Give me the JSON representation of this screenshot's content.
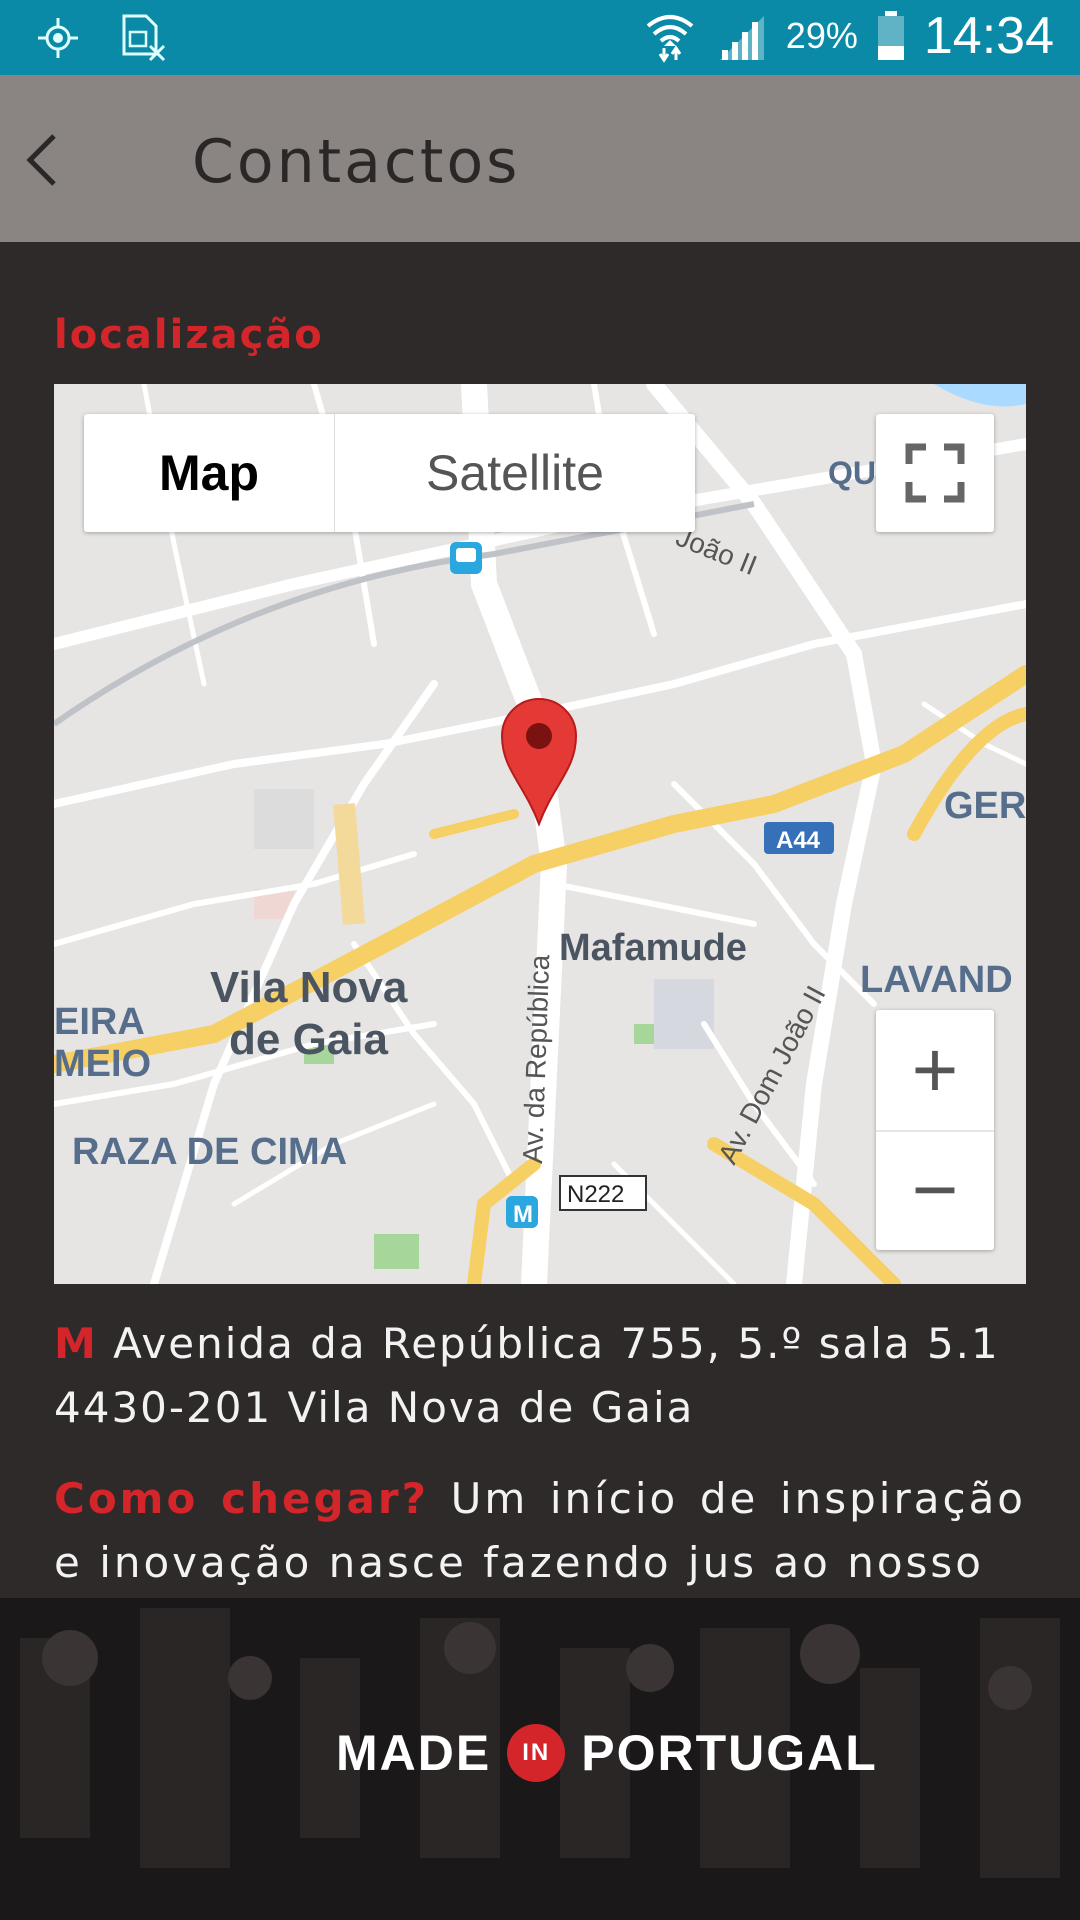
{
  "status_bar": {
    "battery_percent": "29%",
    "time": "14:34",
    "icons": [
      "location-icon",
      "sim-off-icon",
      "wifi-icon",
      "signal-icon",
      "battery-icon"
    ]
  },
  "app_bar": {
    "title": "Contactos",
    "back_icon": "chevron-left-icon"
  },
  "content": {
    "section_label": "localização",
    "map": {
      "type_buttons": {
        "map": "Map",
        "satellite": "Satellite"
      },
      "labels": {
        "city1": "Vila Nova",
        "city2": "de Gaia",
        "district": "Mafamude",
        "street_republica": "Av. da República",
        "street_dom_joao": "Av. Dom João II",
        "street_joao_ii": "João II",
        "road_a44": "A44",
        "road_n222": "N222",
        "area_raza": "RAZA DE CIMA",
        "area_eira": "EIRA",
        "area_meio": "MEIO",
        "area_ger": "GER",
        "area_lavand": "LAVAND",
        "area_qu": "QU",
        "metro": "M"
      },
      "zoom_in": "+",
      "zoom_out": "−"
    },
    "address": {
      "marker": "M",
      "line1": "Avenida da República 755, 5.º sala 5.1",
      "line2": "4430-201 Vila Nova de Gaia"
    },
    "how_to_get": {
      "label": "Como chegar?",
      "text": "Um início de inspiração e inovação nasce fazendo jus ao nosso"
    }
  },
  "footer": {
    "brand_left": "MADE",
    "brand_in": "IN",
    "brand_right": "PORTUGAL"
  },
  "colors": {
    "status_bar": "#0a8aa6",
    "app_bar": "#8a8583",
    "background": "#2e2a29",
    "accent_red": "#d4252b",
    "map_road_yellow": "#f6cf65"
  }
}
